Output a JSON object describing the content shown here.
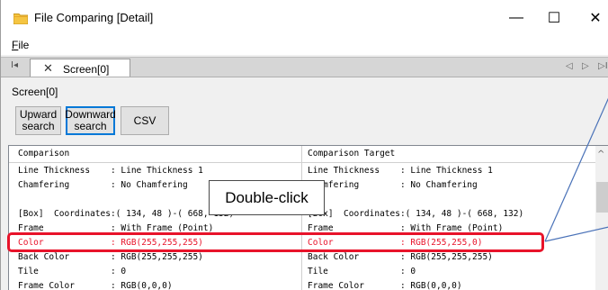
{
  "window": {
    "title": "File Comparing [Detail]",
    "icons": {
      "app": "folder-icon",
      "minimize": "minimize-icon",
      "maximize": "maximize-icon",
      "close": "close-icon"
    },
    "minimize_glyph": "—",
    "maximize_glyph": "☐",
    "close_glyph": "✕"
  },
  "menu": {
    "file_accel": "F",
    "file_rest": "ile"
  },
  "tabs": {
    "first_glyph": "I◂",
    "items": [
      {
        "label": "Screen[0]",
        "close_glyph": "✕"
      }
    ],
    "nav": {
      "prev": "◁",
      "next": "▷",
      "last": "▷I"
    }
  },
  "panel": {
    "screen_label": "Screen[0]",
    "buttons": {
      "upward": "Upward search",
      "downward": "Downward search",
      "csv": "CSV"
    }
  },
  "list": {
    "header": {
      "left": "Comparison",
      "right": "Comparison Target"
    },
    "rows": [
      {
        "left": "Line Thickness    : Line Thickness 1",
        "right": "Line Thickness    : Line Thickness 1",
        "style": "normal"
      },
      {
        "left": "Chamfering        : No Chamfering",
        "right": "Chamfering        : No Chamfering",
        "style": "normal"
      },
      {
        "left": "",
        "right": "",
        "style": "normal"
      },
      {
        "left": "[Box]  Coordinates:( 134, 48 )-( 668, 132)",
        "right": "[Box]  Coordinates:( 134, 48 )-( 668, 132)",
        "style": "normal"
      },
      {
        "left": "Frame             : With Frame (Point)",
        "right": "Frame             : With Frame (Point)",
        "style": "normal"
      },
      {
        "left": "Color             : RGB(255,255,255)",
        "right": "Color             : RGB(255,255,0)",
        "style": "red"
      },
      {
        "left": "Back Color        : RGB(255,255,255)",
        "right": "Back Color        : RGB(255,255,255)",
        "style": "normal"
      },
      {
        "left": "Tile              : 0",
        "right": "Tile              : 0",
        "style": "normal"
      },
      {
        "left": "Frame Color       : RGB(0,0,0)",
        "right": "Frame Color       : RGB(0,0,0)",
        "style": "normal"
      }
    ],
    "scroll_up_glyph": "^"
  },
  "annotation": {
    "callout_text": "Double-click",
    "highlight_color": "#e8132a"
  },
  "colors": {
    "diff_text": "#e8132a",
    "focus_border": "#0078d7",
    "folder": "#f5c542"
  }
}
